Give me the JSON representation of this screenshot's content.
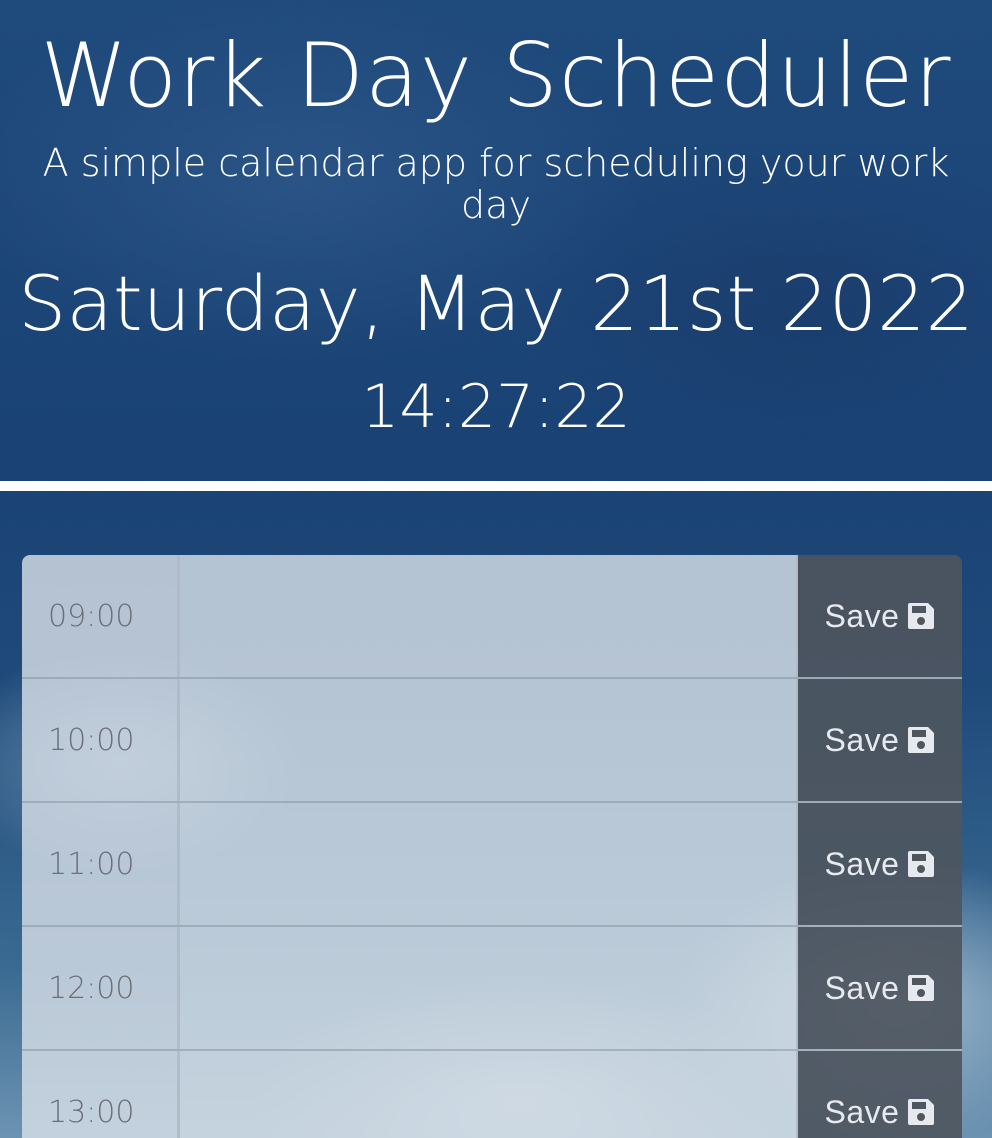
{
  "header": {
    "title": "Work Day Scheduler",
    "subtitle": "A simple calendar app for scheduling your work day",
    "date": "Saturday, May 21st 2022",
    "time": "14:27:22"
  },
  "schedule": {
    "rows": [
      {
        "hour": "09:00",
        "task": "",
        "save_label": "Save"
      },
      {
        "hour": "10:00",
        "task": "",
        "save_label": "Save"
      },
      {
        "hour": "11:00",
        "task": "",
        "save_label": "Save"
      },
      {
        "hour": "12:00",
        "task": "",
        "save_label": "Save"
      },
      {
        "hour": "13:00",
        "task": "",
        "save_label": "Save"
      }
    ]
  },
  "icons": {
    "save": "floppy-disk-icon"
  }
}
